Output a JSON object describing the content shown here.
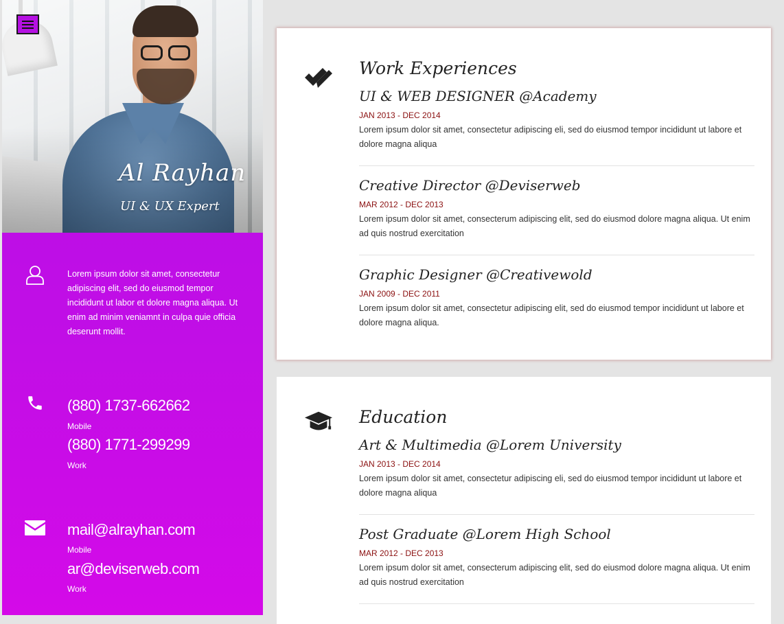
{
  "profile": {
    "name": "Al Rayhan",
    "role": "UI & UX Expert",
    "about": "Lorem ipsum dolor sit amet, consectetur adipiscing elit, sed do eiusmod tempor incididunt ut labor et dolore magna aliqua. Ut enim ad minim veniamnt in culpa quie officia deserunt mollit."
  },
  "contacts": {
    "phones": [
      {
        "value": "(880) 1737-662662",
        "label": "Mobile"
      },
      {
        "value": "(880) 1771-299299",
        "label": "Work"
      }
    ],
    "emails": [
      {
        "value": "mail@alrayhan.com",
        "label": "Mobile"
      },
      {
        "value": "ar@deviserweb.com",
        "label": "Work"
      }
    ]
  },
  "work": {
    "title": "Work Experiences",
    "icon": "double-check-icon",
    "entries": [
      {
        "title": "UI & WEB DESIGNER @Academy",
        "date": "JAN 2013 - DEC 2014",
        "desc": "Lorem ipsum dolor sit amet, consectetur adipiscing eli, sed do eiusmod tempor incididunt ut labore et dolore magna aliqua"
      },
      {
        "title": "Creative Director @Deviserweb",
        "date": "MAR 2012 - DEC 2013",
        "desc": "Lorem ipsum dolor sit amet, consecterum adipiscing elit, sed do eiusmod dolore magna aliqua. Ut enim ad quis nostrud exercitation"
      },
      {
        "title": "Graphic Designer @Creativewold",
        "date": "JAN 2009 - DEC 2011",
        "desc": "Lorem ipsum dolor sit amet, consectetur adipiscing elit, sed do eiusmod tempor incididunt ut labore et dolore magna aliqua."
      }
    ]
  },
  "education": {
    "title": "Education",
    "icon": "graduation-cap-icon",
    "entries": [
      {
        "title": "Art & Multimedia @Lorem University",
        "date": "JAN 2013 - DEC 2014",
        "desc": "Lorem ipsum dolor sit amet, consectetur adipiscing eli, sed do eiusmod tempor incididunt ut labore et dolore magna aliqua"
      },
      {
        "title": "Post Graduate @Lorem High School",
        "date": "MAR 2012 - DEC 2013",
        "desc": "Lorem ipsum dolor sit amet, consecterum adipiscing elit, sed do eiusmod dolore magna aliqua. Ut enim ad quis nostrud exercitation"
      }
    ]
  },
  "colors": {
    "sidebar": "#c10ee6",
    "date": "#8a0f0f",
    "background": "#e4e4e4"
  }
}
